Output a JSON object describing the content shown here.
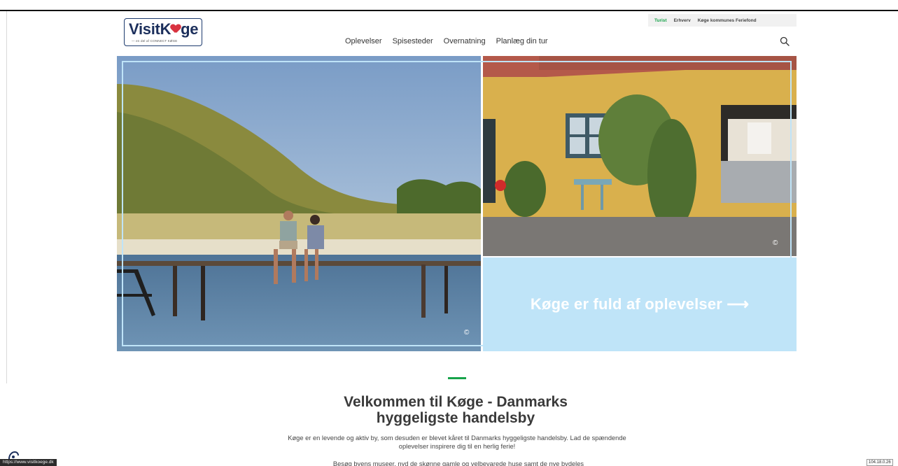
{
  "brand": {
    "logo_text_pre": "VisitK",
    "logo_text_post": "ge",
    "logo_sub": "— en del af CONNECT KØGE"
  },
  "utility_nav": {
    "items": [
      {
        "label": "Turist",
        "active": true
      },
      {
        "label": "Erhverv",
        "active": false
      },
      {
        "label": "Køge kommunes Feriefond",
        "active": false
      }
    ]
  },
  "main_nav": {
    "items": [
      "Oplevelser",
      "Spisesteder",
      "Overnatning",
      "Planlæg din tur"
    ]
  },
  "hero": {
    "cta_label": "Køge er fuld af oplevelser  ⟶",
    "copyright_symbol": "©",
    "cta_color": "#bfe4f8"
  },
  "welcome": {
    "title": "Velkommen til Køge - Danmarks hyggeligste handelsby",
    "body": "Køge er en levende og aktiv by, som desuden er blevet kåret til Danmarks hyggeligste handelsby. Lad de spændende oplevelser inspirere dig til en herlig ferie!",
    "body2": "Besøg byens museer, nyd de skønne gamle og velbevarede huse samt de nye bydeles"
  },
  "browser": {
    "status_url": "https://www.visitkoege.dk",
    "ip_badge": "104.18.0.26"
  },
  "colors": {
    "accent_green": "#17a34a",
    "brand_navy": "#1c2f5c"
  }
}
